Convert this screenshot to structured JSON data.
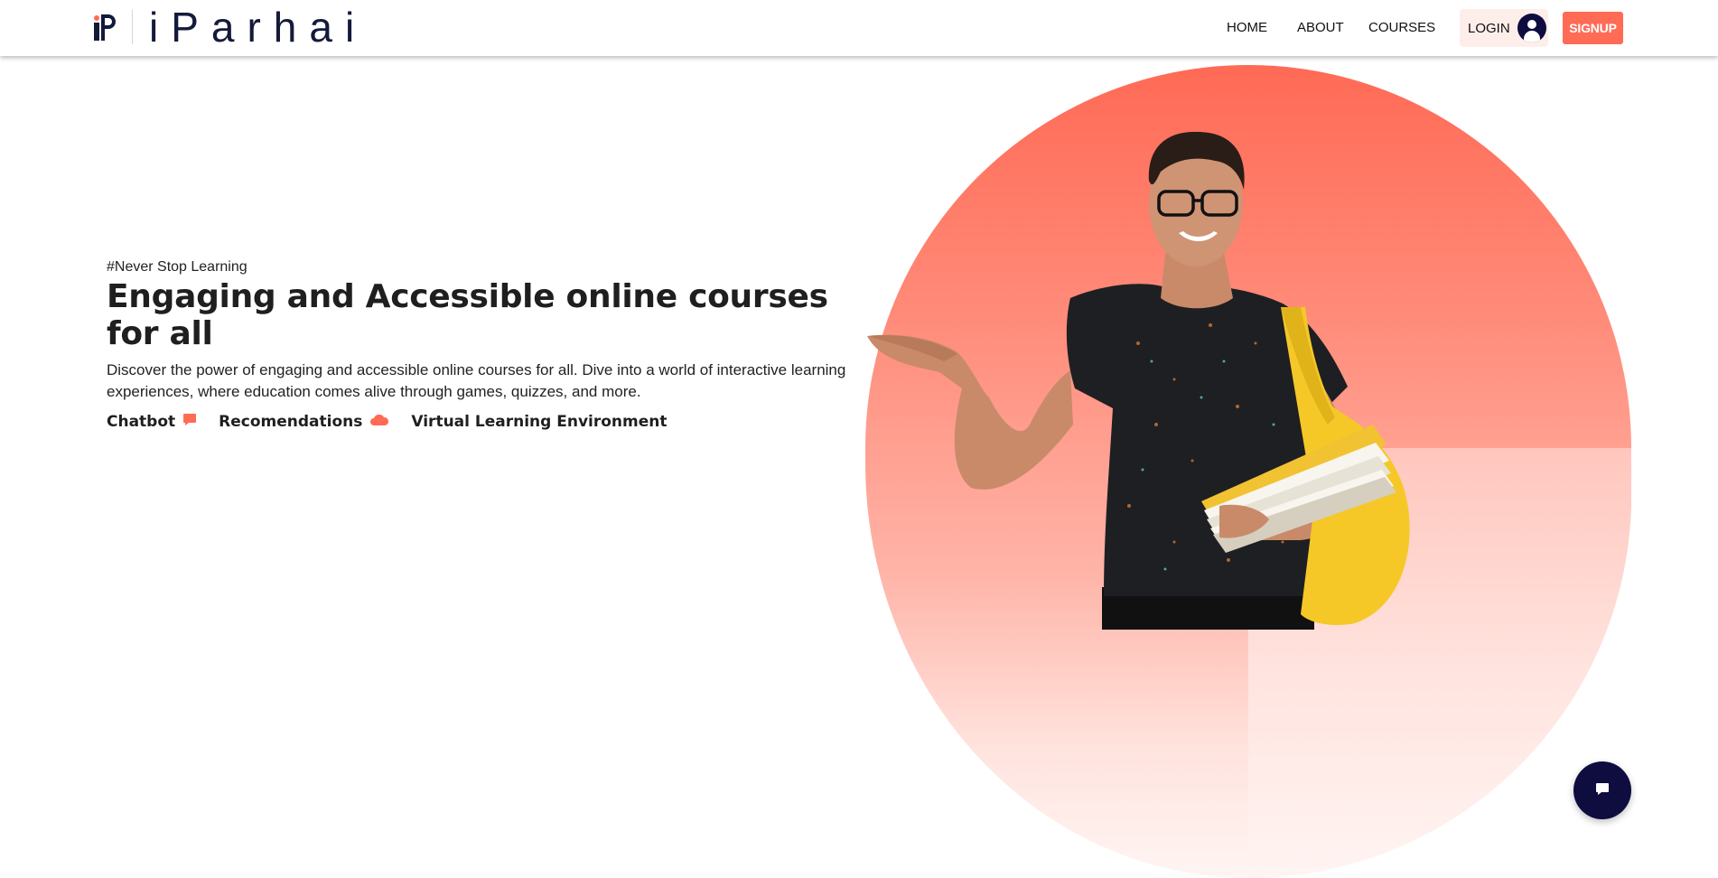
{
  "brand": {
    "name": "iParhai",
    "colors": {
      "primary": "#ff6b55",
      "navy": "#0f0c3f"
    }
  },
  "nav": {
    "items": [
      {
        "label": "HOME"
      },
      {
        "label": "ABOUT"
      },
      {
        "label": "COURSES"
      }
    ],
    "login_label": "LOGIN",
    "signup_label": "SIGNUP"
  },
  "hero": {
    "tagline": "#Never Stop Learning",
    "headline": "Engaging and Accessible online courses for all",
    "description": "Discover the power of engaging and accessible online courses for all. Dive into a world of interactive learning experiences, where education comes alive through games, quizzes, and more.",
    "features": [
      {
        "label": "Chatbot",
        "icon": "chat-icon"
      },
      {
        "label": "Recomendations",
        "icon": "cloud-icon"
      },
      {
        "label": "Virtual Learning Environment",
        "icon": ""
      }
    ]
  },
  "chat_fab": {
    "icon": "chat-icon"
  }
}
